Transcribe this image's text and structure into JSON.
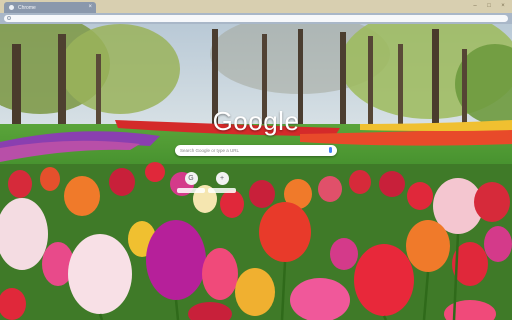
{
  "browser": {
    "tab_title": "Chrome",
    "tab_close": "×",
    "window_controls": [
      "–",
      "□",
      "×"
    ]
  },
  "newtab": {
    "logo": "Google",
    "search_placeholder": "Search Google or type a URL",
    "shortcuts": [
      {
        "icon": "G",
        "label": ""
      },
      {
        "icon": "+",
        "label": ""
      }
    ]
  },
  "theme": {
    "tab_color": "#8a98ac",
    "tabstrip_color": "#d8cfb0",
    "toolbar_color": "#a9b7c8",
    "background_image": "tulip-garden"
  }
}
